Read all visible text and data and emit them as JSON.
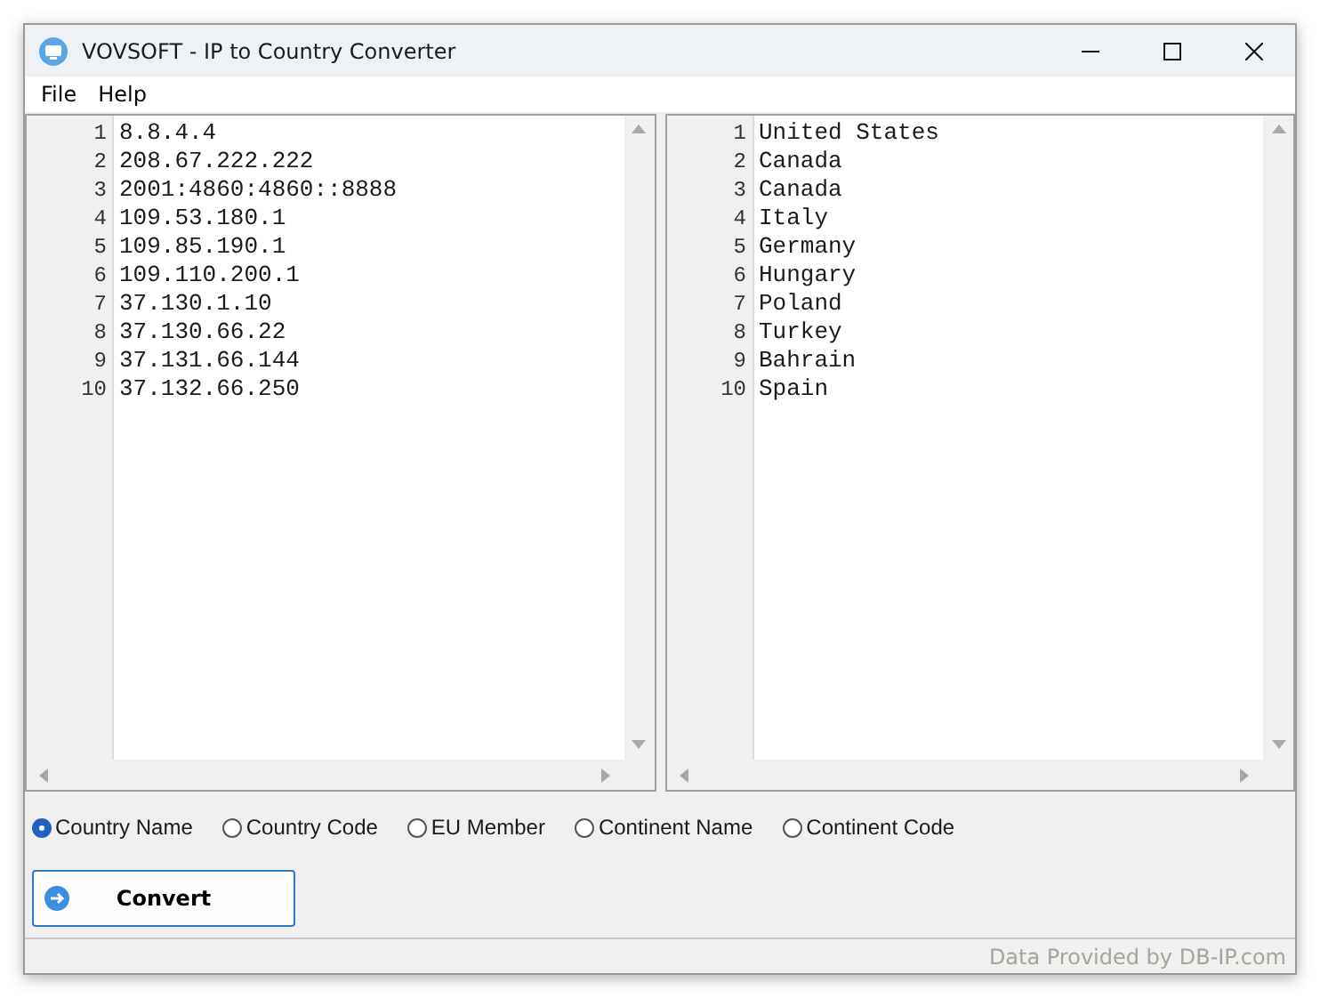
{
  "window": {
    "title": "VOVSOFT - IP to Country Converter"
  },
  "menu": [
    "File",
    "Help"
  ],
  "input_editor": {
    "lines": [
      {
        "number": "1",
        "text": "8.8.4.4"
      },
      {
        "number": "2",
        "text": "208.67.222.222"
      },
      {
        "number": "3",
        "text": "2001:4860:4860::8888"
      },
      {
        "number": "4",
        "text": "109.53.180.1"
      },
      {
        "number": "5",
        "text": "109.85.190.1"
      },
      {
        "number": "6",
        "text": "109.110.200.1"
      },
      {
        "number": "7",
        "text": "37.130.1.10"
      },
      {
        "number": "8",
        "text": "37.130.66.22"
      },
      {
        "number": "9",
        "text": "37.131.66.144"
      },
      {
        "number": "10",
        "text": "37.132.66.250"
      }
    ]
  },
  "output_editor": {
    "lines": [
      {
        "number": "1",
        "text": "United States"
      },
      {
        "number": "2",
        "text": "Canada"
      },
      {
        "number": "3",
        "text": "Canada"
      },
      {
        "number": "4",
        "text": "Italy"
      },
      {
        "number": "5",
        "text": "Germany"
      },
      {
        "number": "6",
        "text": "Hungary"
      },
      {
        "number": "7",
        "text": "Poland"
      },
      {
        "number": "8",
        "text": "Turkey"
      },
      {
        "number": "9",
        "text": "Bahrain"
      },
      {
        "number": "10",
        "text": "Spain"
      }
    ]
  },
  "options": [
    {
      "label": "Country Name",
      "selected": true
    },
    {
      "label": "Country Code",
      "selected": false
    },
    {
      "label": "EU Member",
      "selected": false
    },
    {
      "label": "Continent Name",
      "selected": false
    },
    {
      "label": "Continent Code",
      "selected": false
    }
  ],
  "convert_button": {
    "label": "Convert"
  },
  "status_bar": {
    "text": "Data Provided by DB-IP.com"
  }
}
